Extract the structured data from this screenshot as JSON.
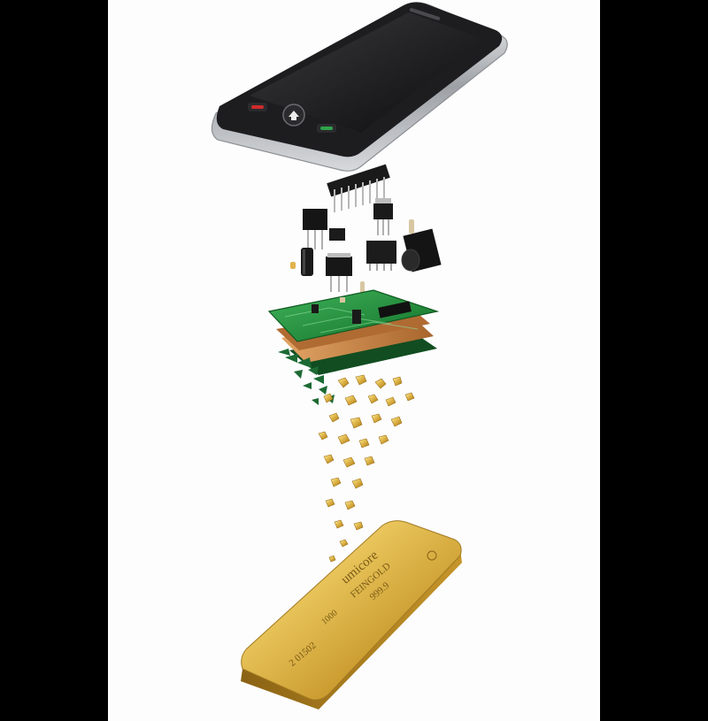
{
  "scene": {
    "subject": "smartphone exploded into circuit boards, electronic components and gold nuggets falling onto a gold bar"
  },
  "colors": {
    "background": "#fdfdfd",
    "letterbox": "#000000",
    "phone_body": "#1d1d1f",
    "phone_bezel": "#b9bcc0",
    "pcb_green": "#1f8a3a",
    "pcb_copper": "#c98a4a",
    "gold": "#d4a93a"
  },
  "gold_bar": {
    "brand": "umicore",
    "metal": "FEINGOLD",
    "purity": "999.9",
    "weight": "1000",
    "serial": "2 01502"
  },
  "phone_buttons": {
    "left_icon": "end-call-icon",
    "center_icon": "home-icon",
    "right_icon": "call-icon"
  }
}
